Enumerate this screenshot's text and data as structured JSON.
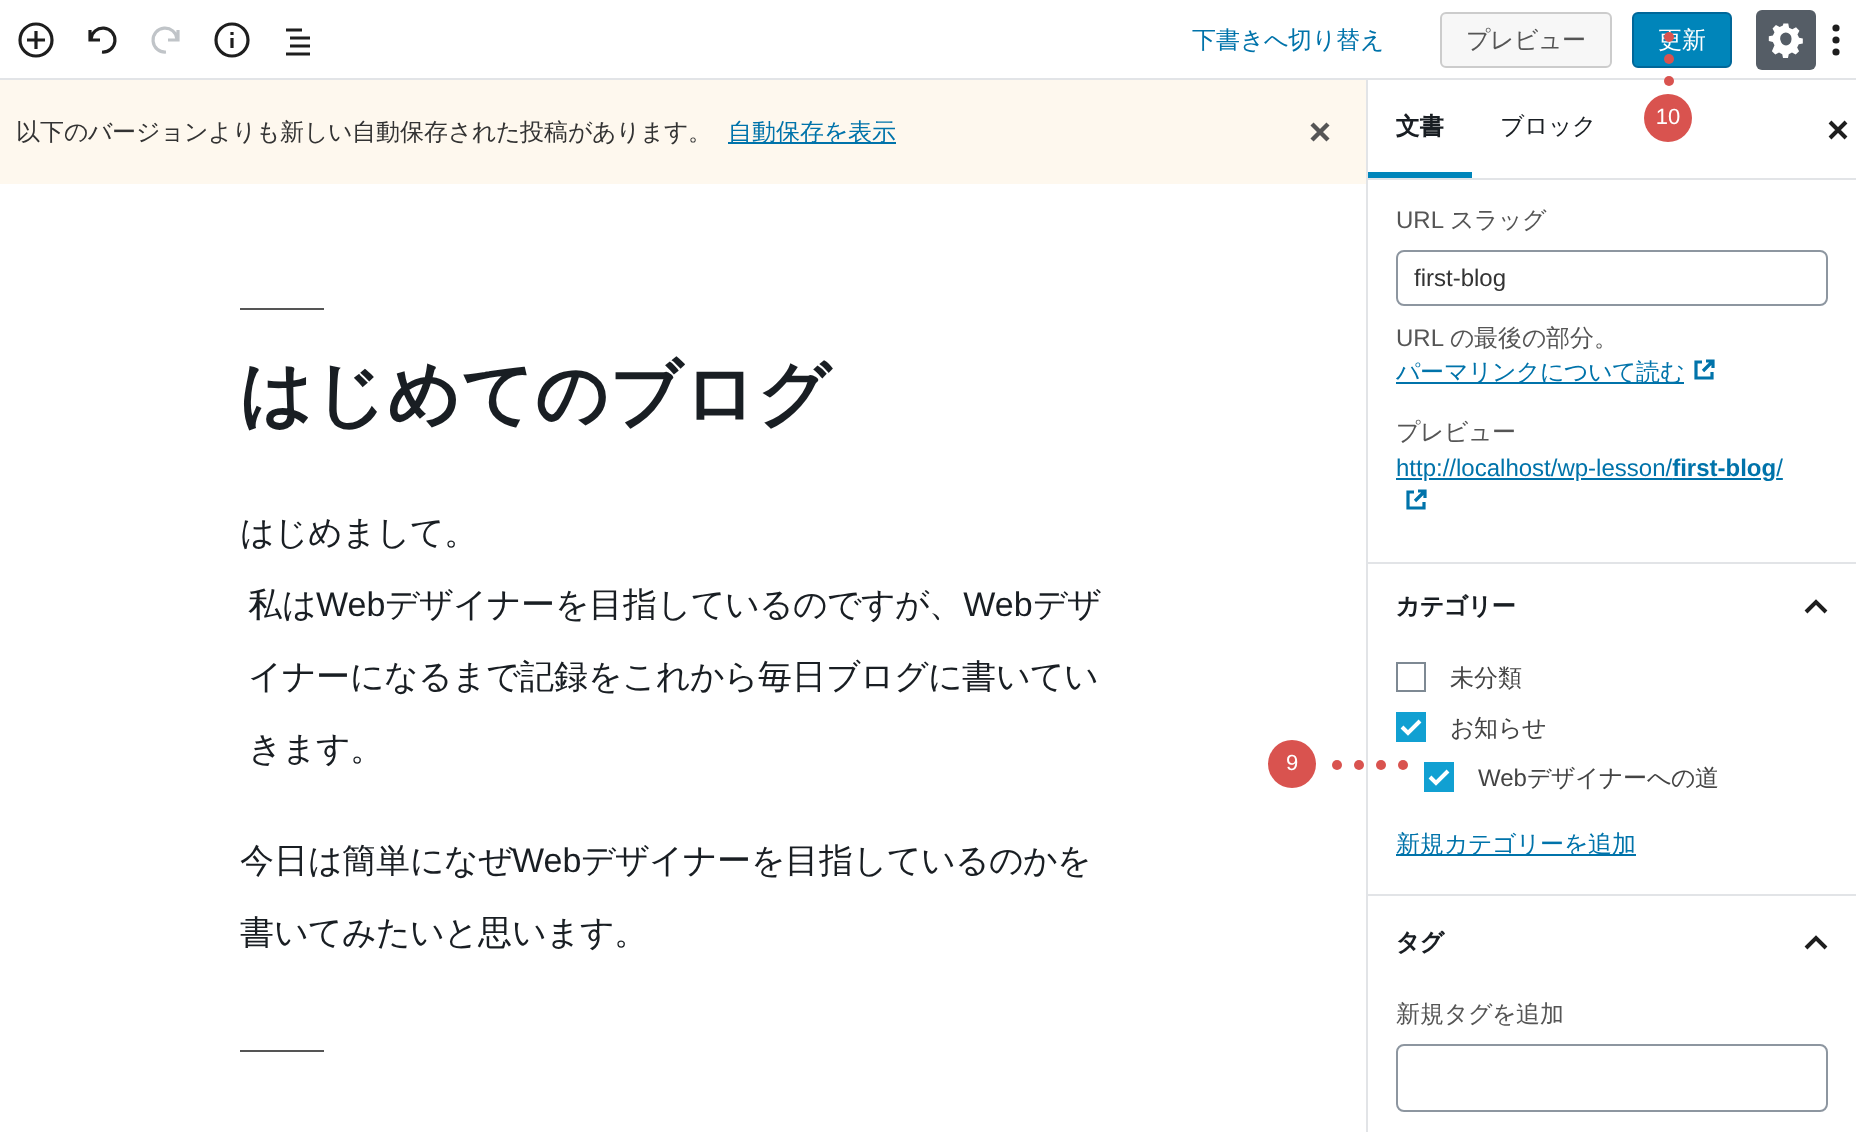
{
  "toolbar": {
    "switch_to_draft": "下書きへ切り替え",
    "preview_button": "プレビュー",
    "update_button": "更新"
  },
  "notice": {
    "text": "以下のバージョンよりも新しい自動保存された投稿があります。",
    "link": "自動保存を表示"
  },
  "post": {
    "title": "はじめてのブログ",
    "paragraphs": [
      "はじめまして。",
      "私はWebデザイナーを目指しているのですが、Webデザイナーになるまで記録をこれから毎日ブログに書いていきます。",
      "今日は簡単になぜWebデザイナーを目指しているのかを書いてみたいと思います。"
    ]
  },
  "sidebar": {
    "tabs": [
      {
        "label": "文書",
        "selected": true
      },
      {
        "label": "ブロック",
        "selected": false
      }
    ],
    "permalink": {
      "label": "URL スラッグ",
      "value": "first-blog",
      "help": "URL の最後の部分。",
      "help_link": "パーマリンクについて読む",
      "preview_label": "プレビュー",
      "preview_url": "http://localhost/wp-lesson/**first-blog**/"
    },
    "categories": {
      "title": "カテゴリー",
      "expanded": true,
      "items": [
        {
          "label": "未分類",
          "checked": false
        },
        {
          "label": "お知らせ",
          "checked": true,
          "children": [
            {
              "label": "Webデザイナーへの道",
              "checked": true
            }
          ]
        }
      ],
      "add_link": "新規カテゴリーを追加"
    },
    "tags": {
      "title": "タグ",
      "expanded": true,
      "label": "新規タグを追加"
    }
  },
  "annotations": [
    {
      "number": "10"
    },
    {
      "number": "9"
    }
  ]
}
